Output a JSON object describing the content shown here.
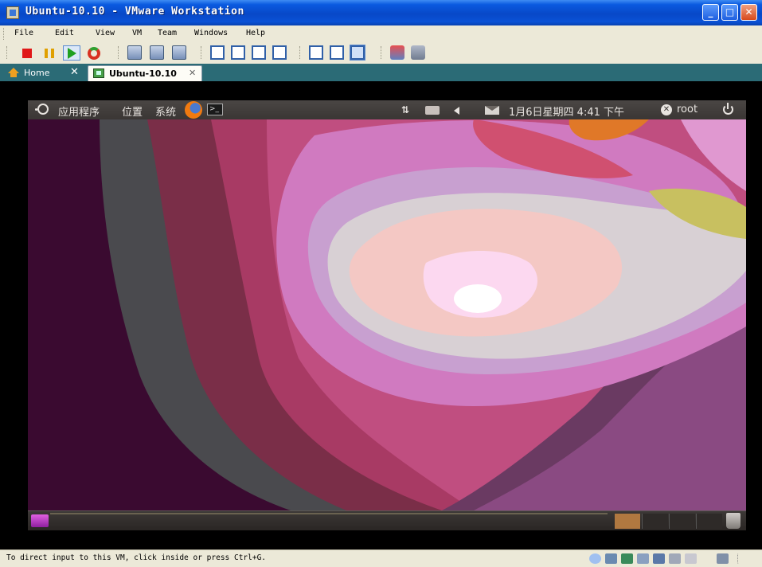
{
  "window": {
    "title": "Ubuntu-10.10 - VMware Workstation",
    "controls": {
      "minimize": "_",
      "maximize": "□",
      "close": "✕"
    }
  },
  "menubar": {
    "items": [
      "File",
      "Edit",
      "View",
      "VM",
      "Team",
      "Windows",
      "Help"
    ]
  },
  "toolbar": {
    "icons": [
      "power-off-icon",
      "suspend-icon",
      "power-on-icon",
      "reset-icon",
      "snapshot-icon",
      "revert-snapshot-icon",
      "snapshot-manager-icon",
      "quick-switch-icon",
      "fullscreen-icon",
      "unity-icon",
      "console-view-icon",
      "summary-view-icon",
      "appliance-view-icon",
      "team-icon",
      "team-settings-icon"
    ]
  },
  "tabs": [
    {
      "label": "Home",
      "close": "✕",
      "active": false
    },
    {
      "label": "Ubuntu-10.10",
      "close": "✕",
      "active": true
    }
  ],
  "guest": {
    "top_panel": {
      "menus": [
        "应用程序",
        "位置",
        "系统"
      ],
      "terminal_glyph": ">_",
      "network_glyph": "⇅",
      "clock": "1月6日星期四 4:41 下午",
      "user_glyph": "✕",
      "user": "root"
    },
    "bottom_panel": {
      "active_workspace_color": "#b07840"
    }
  },
  "statusbar": {
    "text": "To direct input to this VM, click inside or press Ctrl+G."
  },
  "colors": {
    "titlebar": "#0a52d6",
    "tabbar": "#2b6b76",
    "chrome": "#ece9d8",
    "panel": "#3a3634"
  }
}
